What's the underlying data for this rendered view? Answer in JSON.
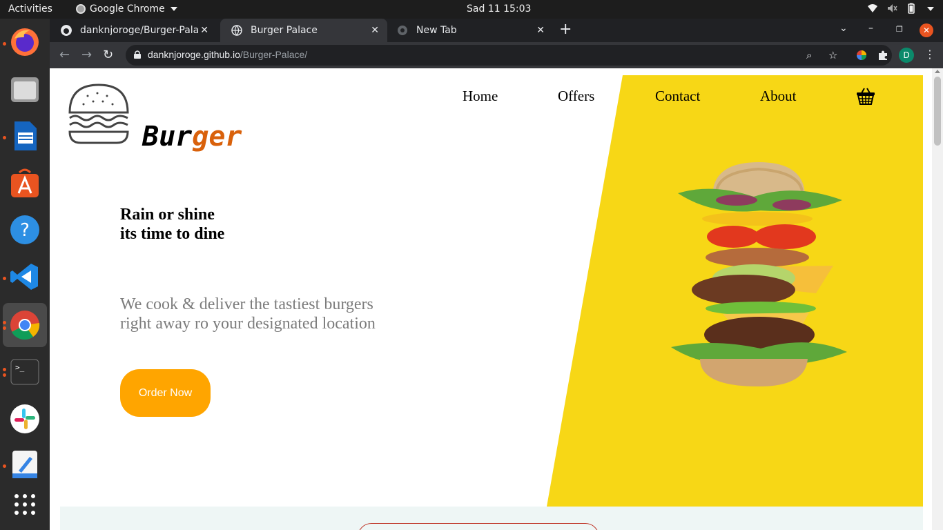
{
  "system": {
    "activities": "Activities",
    "app_name": "Google Chrome",
    "clock": "Sad 11  15:03"
  },
  "browser": {
    "tabs": [
      {
        "title": "danknjoroge/Burger-Pala",
        "favicon": "github-icon",
        "active": false
      },
      {
        "title": "Burger Palace",
        "favicon": "globe-icon",
        "active": true
      },
      {
        "title": "New Tab",
        "favicon": "chrome-icon",
        "active": false
      }
    ],
    "url_host": "danknjoroge.github.io",
    "url_path": "/Burger-Palace/",
    "profile_initial": "D"
  },
  "site": {
    "brand_part1": "Bur",
    "brand_part2": "ger",
    "nav": [
      "Home",
      "Offers",
      "Contact",
      "About"
    ],
    "headline_line1": "Rain or shine",
    "headline_line2": "its time to dine",
    "sub_line1": "We cook & deliver the tastiest burgers",
    "sub_line2": "right away ro your designated location",
    "cta": "Order Now"
  },
  "colors": {
    "accent_yellow": "#f7d716",
    "cta_orange": "#ffa500",
    "brand_orange": "#d9610b"
  }
}
